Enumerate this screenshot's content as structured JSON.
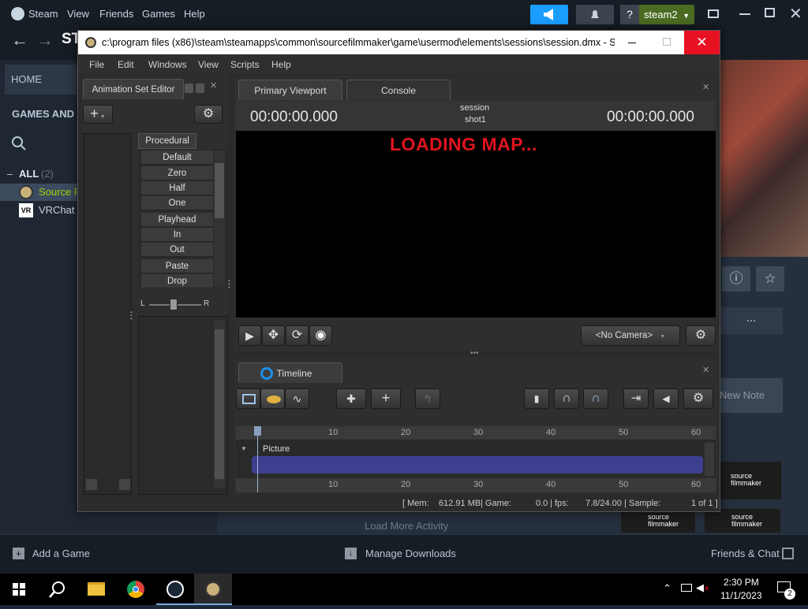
{
  "steam": {
    "menu": [
      "Steam",
      "View",
      "Friends",
      "Games",
      "Help"
    ],
    "account_name": "steam2",
    "help_label": "?",
    "nav_title": "ST",
    "home_label": "HOME",
    "games_label": "GAMES AND S",
    "all_label": "ALL",
    "all_count": "(2)",
    "games": [
      {
        "name": "Source F",
        "color": "#a4d007"
      },
      {
        "name": "VRChat",
        "color": "#c7d5e0"
      }
    ],
    "new_note": "New Note",
    "load_more": "Load More Activity",
    "add_game": "Add a Game",
    "manage_downloads": "Manage Downloads",
    "friends_chat": "Friends & Chat",
    "more_dots": "...",
    "sfm_badge_line1": "source",
    "sfm_badge_line2": "filmmaker"
  },
  "sfm": {
    "title": "c:\\program files (x86)\\steam\\steamapps\\common\\sourcefilmmaker\\game\\usermod\\elements\\sessions\\session.dmx - S...",
    "menu": [
      "File",
      "Edit",
      "Windows",
      "View",
      "Scripts",
      "Help"
    ],
    "anim_set_editor_tab": "Animation Set Editor",
    "procedural_tab": "Procedural",
    "procedural_items": [
      "Default",
      "Zero",
      "Half",
      "One",
      "Playhead",
      "In",
      "Out",
      "Paste",
      "Drop"
    ],
    "slider_left": "L",
    "slider_right": "R",
    "viewport_tab": "Primary Viewport",
    "console_tab": "Console",
    "session_label": "session",
    "shot_label": "shot1",
    "time_left": "00:00:00.000",
    "time_right": "00:00:00.000",
    "loading_text": "LOADING MAP...",
    "camera_label": "<No Camera>",
    "timeline_tab": "Timeline",
    "ruler_ticks": [
      "10",
      "20",
      "30",
      "40",
      "50",
      "60"
    ],
    "track_label": "Picture",
    "status": {
      "mem_label": "[ Mem:",
      "mem_value": "612.91 MB",
      "game_label": "| Game:",
      "game_value": "0.0",
      "fps_label": "| fps:",
      "fps_value": "7.8/24.00",
      "sample_label": "| Sample:",
      "sample_value": "1 of 1 ]"
    },
    "loading_color": "#e0141e"
  },
  "taskbar": {
    "time": "2:30 PM",
    "date": "11/1/2023",
    "notification_count": "2"
  }
}
